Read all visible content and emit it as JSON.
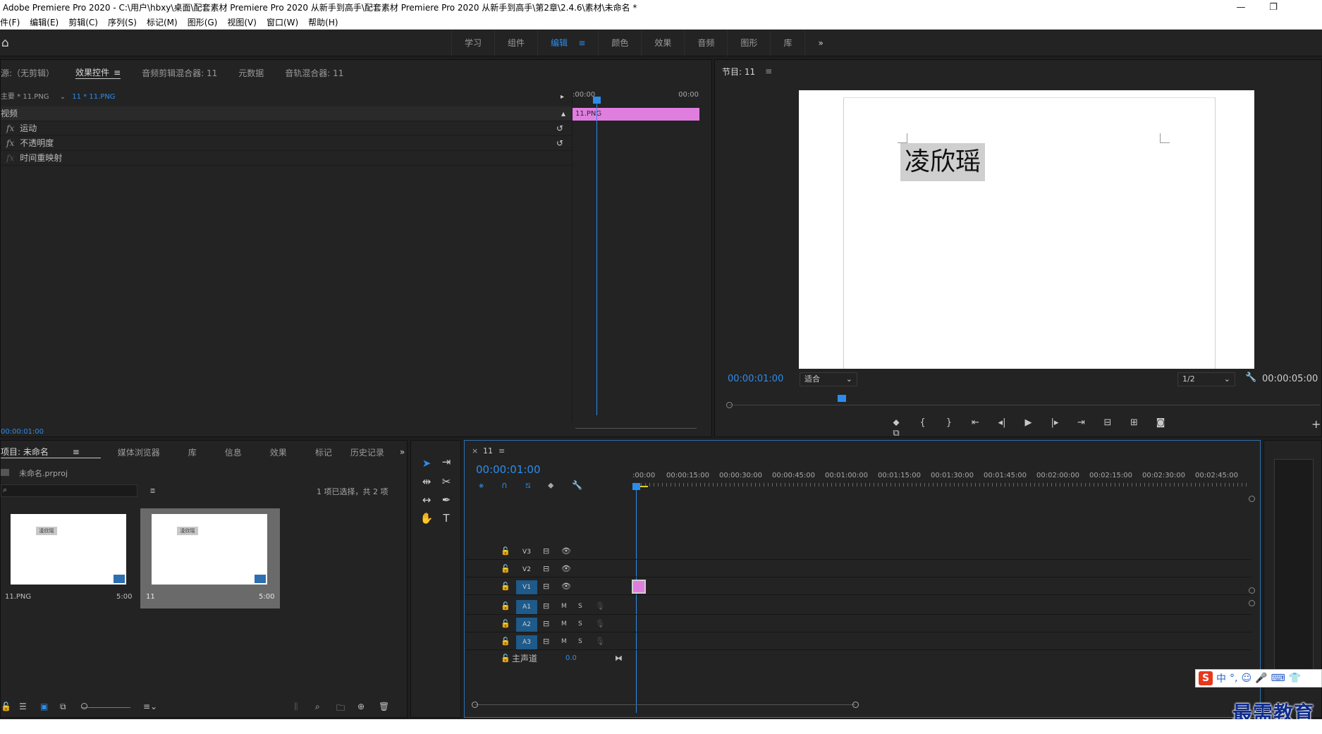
{
  "window": {
    "title": "Adobe Premiere Pro 2020 - C:\\用户\\hbxy\\桌面\\配套素材 Premiere Pro 2020 从新手到高手\\配套素材 Premiere Pro 2020 从新手到高手\\第2章\\2.4.6\\素材\\未命名 *",
    "minimize": "—",
    "restore": "❐"
  },
  "menu": [
    "件(F)",
    "编辑(E)",
    "剪辑(C)",
    "序列(S)",
    "标记(M)",
    "图形(G)",
    "视图(V)",
    "窗口(W)",
    "帮助(H)"
  ],
  "workspaces": {
    "tabs": [
      "学习",
      "组件",
      "编辑",
      "颜色",
      "效果",
      "音频",
      "图形",
      "库"
    ],
    "active": "编辑",
    "menu_glyph": "≡",
    "more": "»"
  },
  "source_panel": {
    "tabs": [
      "源:（无剪辑）",
      "效果控件",
      "音频剪辑混合器: 11",
      "元数据",
      "音轨混合器: 11"
    ],
    "active_tab": "效果控件",
    "master": "主要 * 11.PNG",
    "clip": "11 * 11.PNG",
    "section": "视频",
    "effects": [
      "运动",
      "不透明度",
      "时间重映射"
    ],
    "fx_symbol": "fx",
    "mini_timeline": {
      "start": ":00:00",
      "end": "00:00",
      "clip_label": "11.PNG",
      "clip_color": "#e07ee0"
    },
    "timecode": "00:00:01:00"
  },
  "program": {
    "title": "节目: 11",
    "menu_glyph": "≡",
    "text_in_frame": "凌欣瑶",
    "timecode": "00:00:01:00",
    "fit": "适合",
    "resolution": "1/2",
    "duration": "00:00:05:00",
    "transport_icons": [
      "marker-icon",
      "mark-in-icon",
      "mark-out-icon",
      "go-to-in-icon",
      "step-back-icon",
      "play-icon",
      "step-forward-icon",
      "go-to-out-icon",
      "insert-icon",
      "overwrite-icon",
      "export-frame-icon",
      "compare-icon"
    ],
    "transport_glyphs": [
      "⬥",
      "{",
      "}",
      "⇤",
      "◂|",
      "▶",
      "|▸",
      "⇥",
      "⊟",
      "⊞",
      "◙",
      "⧉"
    ],
    "add": "+"
  },
  "project": {
    "tabs": [
      "项目: 未命名",
      "媒体浏览器",
      "库",
      "信息",
      "效果",
      "标记",
      "历史记录"
    ],
    "active_tab": "项目: 未命名",
    "file": "未命名.prproj",
    "selection": "1 项已选择，共 2 项",
    "items": [
      {
        "name": "11.PNG",
        "duration": "5:00",
        "thumb_text": "凌欣瑶"
      },
      {
        "name": "11",
        "duration": "5:00",
        "thumb_text": "凌欣瑶"
      }
    ]
  },
  "timeline": {
    "tab": "11",
    "close": "×",
    "menu_glyph": "≡",
    "timecode": "00:00:01:00",
    "ruler": [
      ":00:00",
      "00:00:15:00",
      "00:00:30:00",
      "00:00:45:00",
      "00:01:00:00",
      "00:01:15:00",
      "00:01:30:00",
      "00:01:45:00",
      "00:02:00:00",
      "00:02:15:00",
      "00:02:30:00",
      "00:02:45:00"
    ],
    "video_tracks": [
      "V3",
      "V2",
      "V1"
    ],
    "audio_tracks": [
      "A1",
      "A2",
      "A3"
    ],
    "master": "主声道",
    "master_value": "0.0",
    "mute": "M",
    "solo": "S",
    "clip_color": "#e07ee0"
  },
  "ime": {
    "logo": "S",
    "lang": "中",
    "punct": "°,",
    "icons": [
      "☺",
      "🎤",
      "⌨",
      "👕"
    ]
  },
  "watermark": "最需教育"
}
